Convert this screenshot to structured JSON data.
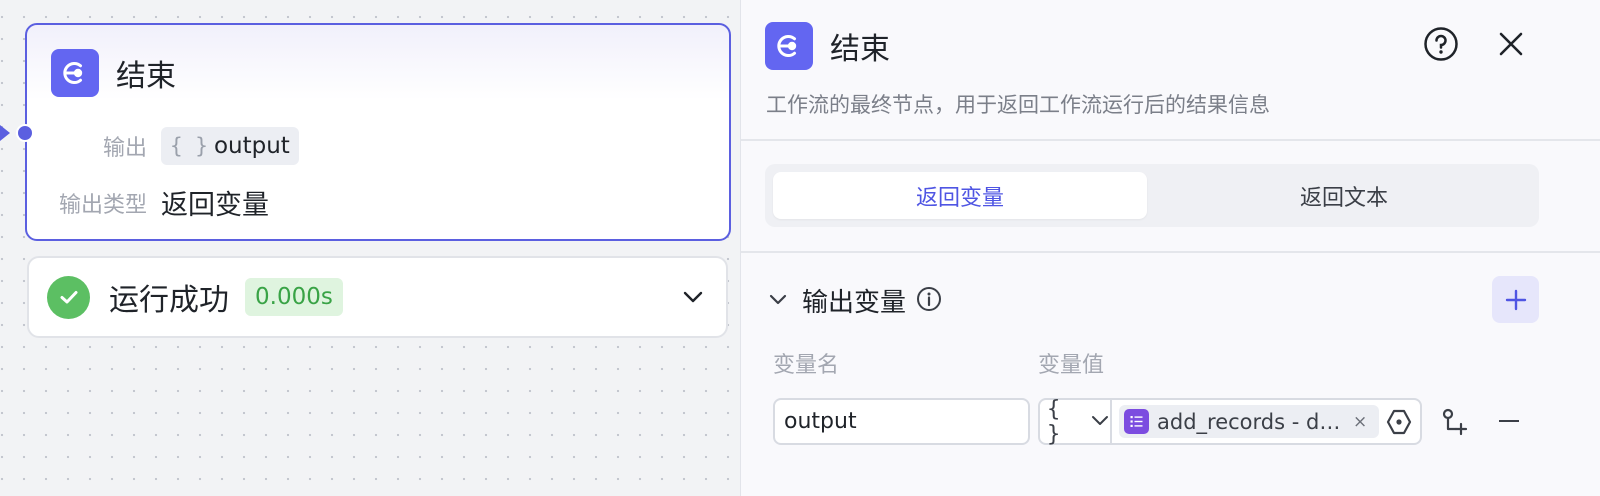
{
  "node": {
    "title": "结束",
    "output_label": "输出",
    "output_var": "output",
    "type_label": "输出类型",
    "type_value": "返回变量",
    "icon": "end-node-icon"
  },
  "run": {
    "status": "运行成功",
    "duration": "0.000s",
    "status_color": "#5cbf63"
  },
  "panel": {
    "title": "结束",
    "description": "工作流的最终节点，用于返回工作流运行后的结果信息",
    "tabs": [
      {
        "label": "返回变量",
        "active": true
      },
      {
        "label": "返回文本",
        "active": false
      }
    ],
    "section_title": "输出变量",
    "columns": {
      "name": "变量名",
      "value": "变量值"
    },
    "rows": [
      {
        "name": "output",
        "type": "{ }",
        "ref": "add_records - data",
        "remove": "×"
      }
    ]
  },
  "colors": {
    "accent": "#5b5fe0",
    "node_icon": "#6366f1",
    "ref_icon": "#7c4ce0"
  }
}
